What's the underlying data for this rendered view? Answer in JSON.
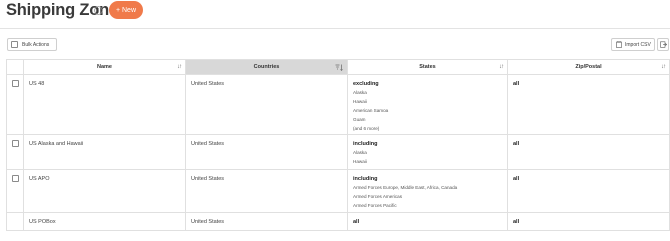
{
  "header": {
    "title": "Shipping Zones",
    "new_button": "+ New"
  },
  "toolbar": {
    "bulk_actions": "Bulk Actions",
    "import_csv": "Import CSV"
  },
  "table": {
    "columns": [
      {
        "label": "Name"
      },
      {
        "label": "Countries"
      },
      {
        "label": "States"
      },
      {
        "label": "Zip/Postal"
      }
    ],
    "rows": [
      {
        "name": "US 48",
        "countries": "United States",
        "states_mode": "excluding",
        "states": [
          "Alaska",
          "Hawaii",
          "American Samoa",
          "Guam",
          "(and 6 more)"
        ],
        "zip": "all",
        "has_checkbox": true
      },
      {
        "name": "US Alaska and Hawaii",
        "countries": "United States",
        "states_mode": "including",
        "states": [
          "Alaska",
          "Hawaii"
        ],
        "zip": "all",
        "has_checkbox": true
      },
      {
        "name": "US APO",
        "countries": "United States",
        "states_mode": "including",
        "states": [
          "Armed Forces Europe, Middle East, Africa, Canada",
          "Armed Forces Americas",
          "Armed Forces Pacific"
        ],
        "zip": "all",
        "has_checkbox": true
      },
      {
        "name": "US POBox",
        "countries": "United States",
        "states_mode": "all",
        "states": [],
        "zip": "all",
        "has_checkbox": false
      }
    ]
  }
}
